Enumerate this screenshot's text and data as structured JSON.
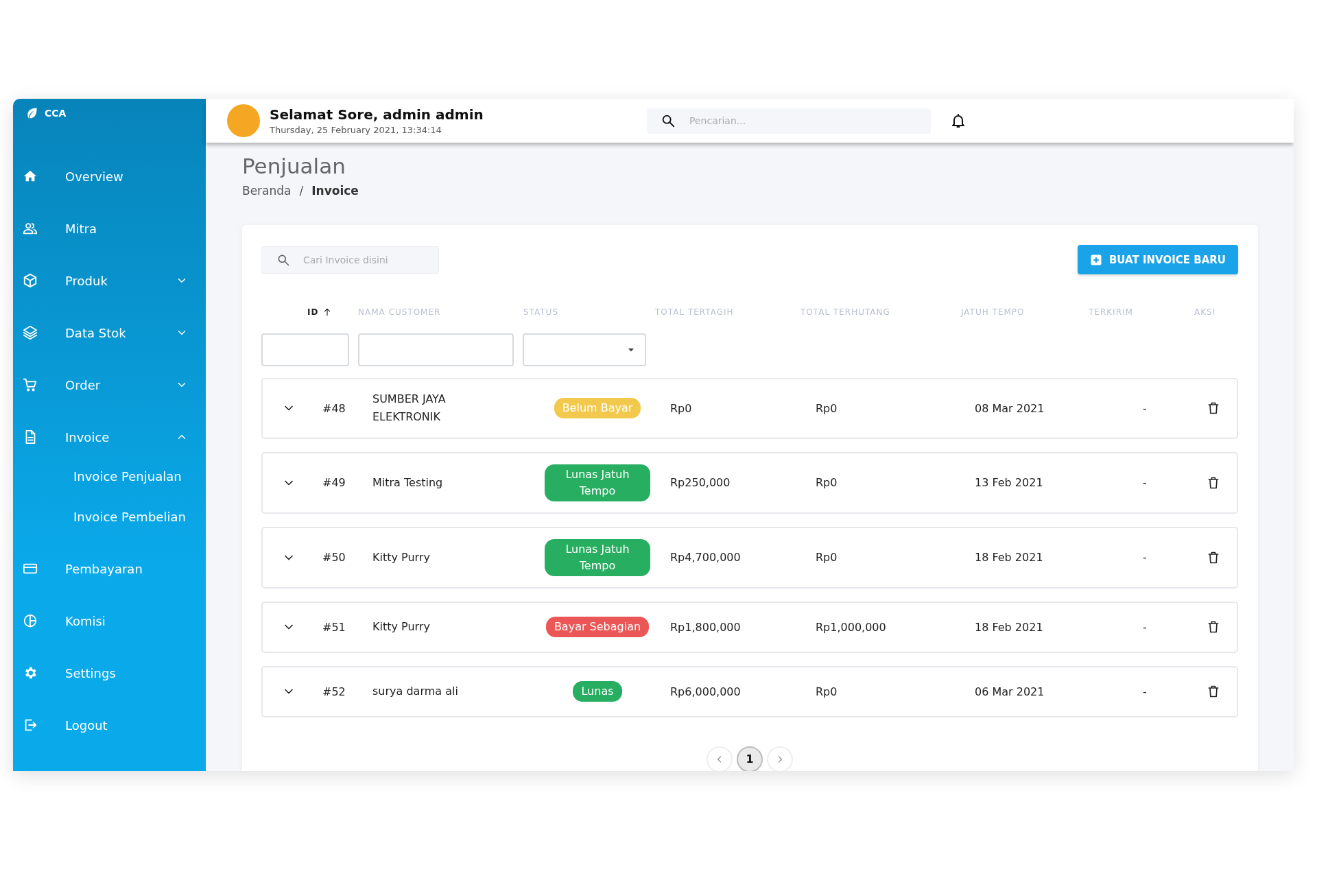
{
  "sidebar": {
    "logo": "CCA",
    "items": [
      {
        "label": "Overview",
        "kind": "link"
      },
      {
        "label": "Mitra",
        "kind": "link"
      },
      {
        "label": "Produk",
        "kind": "group",
        "expanded": false
      },
      {
        "label": "Data Stok",
        "kind": "group",
        "expanded": false
      },
      {
        "label": "Order",
        "kind": "group",
        "expanded": false
      },
      {
        "label": "Invoice",
        "kind": "group",
        "expanded": true,
        "children": [
          {
            "label": "Invoice Penjualan"
          },
          {
            "label": "Invoice Pembelian"
          }
        ]
      },
      {
        "label": "Pembayaran",
        "kind": "link"
      },
      {
        "label": "Komisi",
        "kind": "link"
      },
      {
        "label": "Settings",
        "kind": "link"
      },
      {
        "label": "Logout",
        "kind": "link"
      }
    ]
  },
  "header": {
    "greeting": "Selamat Sore, admin admin",
    "datetime": "Thursday, 25 February 2021, 13:34:14",
    "search": {
      "placeholder": "Pencarian..."
    }
  },
  "page": {
    "title": "Penjualan",
    "breadcrumb": [
      {
        "label": "Beranda",
        "current": false
      },
      {
        "label": "Invoice",
        "current": true
      }
    ],
    "breadcrumb_separator": "/"
  },
  "table": {
    "search": {
      "placeholder": "Cari Invoice disini"
    },
    "new_button": "BUAT INVOICE BARU",
    "columns": [
      {
        "label": "ID",
        "sorted": true
      },
      {
        "label": "NAMA CUSTOMER",
        "sorted": false
      },
      {
        "label": "STATUS",
        "sorted": false
      },
      {
        "label": "TOTAL TERTAGIH",
        "sorted": false
      },
      {
        "label": "TOTAL TERHUTANG",
        "sorted": false
      },
      {
        "label": "JATUH TEMPO",
        "sorted": false
      },
      {
        "label": "TERKIRIM",
        "sorted": false
      },
      {
        "label": "AKSI",
        "sorted": false
      }
    ],
    "filters": [
      {
        "kind": "text"
      },
      {
        "kind": "text"
      },
      {
        "kind": "select"
      }
    ],
    "rows": [
      {
        "id": "#48",
        "customer": "SUMBER JAYA ELEKTRONIK",
        "status": "Belum Bayar",
        "color": "#f2c94c",
        "total_tertagih": "Rp0",
        "total_terhutang": "Rp0",
        "jatuh_tempo": "08 Mar 2021",
        "terkirim": "-",
        "expanded": false
      },
      {
        "id": "#49",
        "customer": "Mitra Testing",
        "status": "Lunas Jatuh Tempo",
        "color": "#27ae60",
        "total_tertagih": "Rp250,000",
        "total_terhutang": "Rp0",
        "jatuh_tempo": "13 Feb 2021",
        "terkirim": "-",
        "expanded": false
      },
      {
        "id": "#50",
        "customer": "Kitty Purry",
        "status": "Lunas Jatuh Tempo",
        "color": "#27ae60",
        "total_tertagih": "Rp4,700,000",
        "total_terhutang": "Rp0",
        "jatuh_tempo": "18 Feb 2021",
        "terkirim": "-",
        "expanded": false
      },
      {
        "id": "#51",
        "customer": "Kitty Purry",
        "status": "Bayar Sebagian",
        "color": "#eb5757",
        "total_tertagih": "Rp1,800,000",
        "total_terhutang": "Rp1,000,000",
        "jatuh_tempo": "18 Feb 2021",
        "terkirim": "-",
        "expanded": false
      },
      {
        "id": "#52",
        "customer": "surya darma ali",
        "status": "Lunas",
        "color": "#27ae60",
        "total_tertagih": "Rp6,000,000",
        "total_terhutang": "Rp0",
        "jatuh_tempo": "06 Mar 2021",
        "terkirim": "-",
        "expanded": false
      }
    ]
  },
  "pagination": {
    "pages": [
      {
        "label": "1",
        "selected": true
      }
    ]
  }
}
